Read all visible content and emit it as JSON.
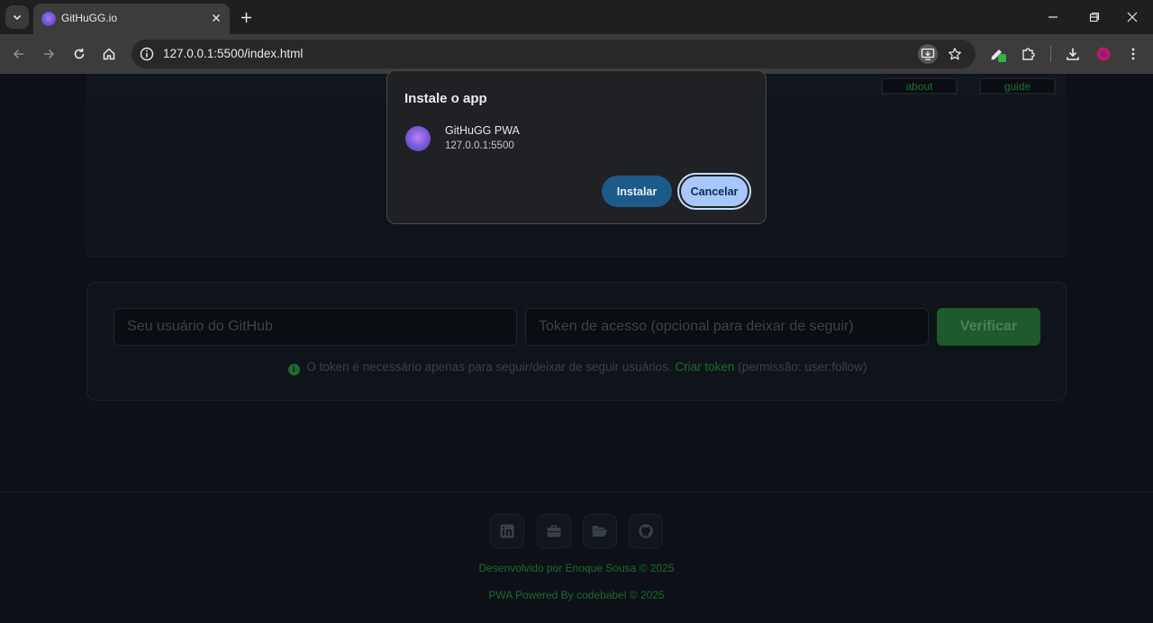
{
  "browser": {
    "tab": {
      "title": "GitHuGG.io"
    },
    "address": {
      "url": "127.0.0.1:5500/index.html"
    }
  },
  "page": {
    "nav": {
      "about": "about",
      "guide": "guide"
    },
    "form": {
      "username_placeholder": "Seu usuário do GitHub",
      "token_placeholder": "Token de acesso (opcional para deixar de seguir)",
      "verify_label": "Verificar",
      "hint_text": "O token é necessário apenas para seguir/deixar de seguir usuários.",
      "hint_link": "Criar token",
      "hint_suffix": "(permissão: user:follow)"
    },
    "footer": {
      "credit": "Desenvolvido por Enoque Sousa © 2025",
      "powered": "PWA Powered By codebabel © 2025"
    }
  },
  "dialog": {
    "title": "Instale o app",
    "app_name": "GitHuGG PWA",
    "app_origin": "127.0.0.1:5500",
    "install_label": "Instalar",
    "cancel_label": "Cancelar"
  }
}
